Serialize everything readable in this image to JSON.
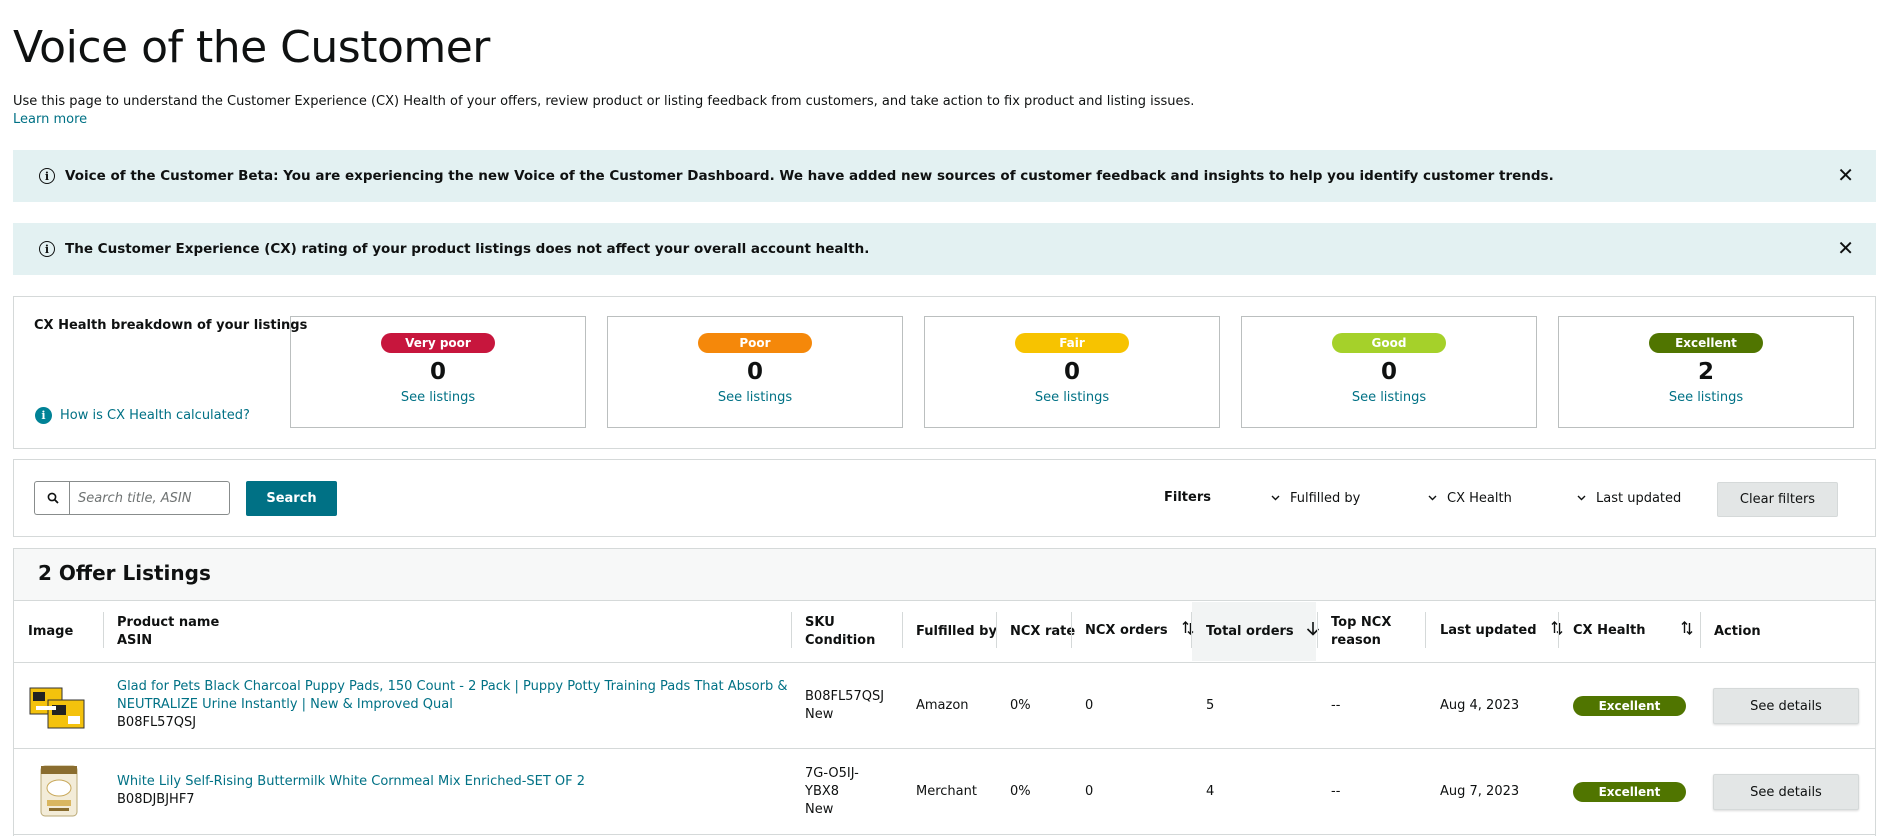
{
  "header": {
    "title": "Voice of the Customer",
    "description": "Use this page to understand the Customer Experience (CX) Health of your offers, review product or listing feedback from customers, and take action to fix product and listing issues.",
    "learn_more": "Learn more"
  },
  "alerts": [
    {
      "icon": "info-icon",
      "message": "Voice of the Customer Beta: You are experiencing the new Voice of the Customer Dashboard. We have added new sources of customer feedback and insights to help you identify customer trends.",
      "close": "✕"
    },
    {
      "icon": "info-icon",
      "message": "The Customer Experience (CX) rating of your product listings does not affect your overall account health.",
      "close": "✕"
    }
  ],
  "cx_breakdown": {
    "title": "CX Health breakdown of your listings",
    "help_link": "How is CX Health calculated?",
    "cards": [
      {
        "label": "Very poor",
        "count": "0",
        "link": "See listings",
        "color": "#c7163d"
      },
      {
        "label": "Poor",
        "count": "0",
        "link": "See listings",
        "color": "#f5880a"
      },
      {
        "label": "Fair",
        "count": "0",
        "link": "See listings",
        "color": "#f7c300"
      },
      {
        "label": "Good",
        "count": "0",
        "link": "See listings",
        "color": "#a5d12a"
      },
      {
        "label": "Excellent",
        "count": "2",
        "link": "See listings",
        "color": "#507500"
      }
    ]
  },
  "search": {
    "placeholder": "Search title, ASIN",
    "button": "Search",
    "filters_label": "Filters",
    "filters": [
      "Fulfilled by",
      "CX Health",
      "Last updated"
    ],
    "clear_button": "Clear filters"
  },
  "table": {
    "title": "2 Offer Listings",
    "columns": {
      "image": "Image",
      "product_name": "Product name",
      "asin": "ASIN",
      "sku": "SKU",
      "condition": "Condition",
      "fulfilled_by": "Fulfilled by",
      "ncx_rate": "NCX rate",
      "ncx_orders": "NCX orders",
      "total_orders": "Total orders",
      "top_ncx_reason_1": "Top NCX",
      "top_ncx_reason_2": "reason",
      "last_updated": "Last updated",
      "cx_health": "CX Health",
      "action": "Action"
    },
    "rows": [
      {
        "name_line1": "Glad for Pets Black Charcoal Puppy Pads, 150 Count - 2 Pack | Puppy Potty Training Pads That Absorb &",
        "name_line2": "NEUTRALIZE Urine Instantly | New & Improved Qual",
        "asin": "B08FL57QSJ",
        "sku_line1": "B08FL57QSJ",
        "sku_line2": "",
        "condition": "New",
        "fulfilled_by": "Amazon",
        "ncx_rate": "0%",
        "ncx_orders": "0",
        "total_orders": "5",
        "top_ncx_reason": "--",
        "last_updated": "Aug 4, 2023",
        "cx_health": "Excellent",
        "action": "See details"
      },
      {
        "name_line1": "White Lily Self-Rising Buttermilk White Cornmeal Mix Enriched-SET OF 2",
        "name_line2": "",
        "asin": "B08DJBJHF7",
        "sku_line1": "7G-O5IJ-",
        "sku_line2": "YBX8",
        "condition": "New",
        "fulfilled_by": "Merchant",
        "ncx_rate": "0%",
        "ncx_orders": "0",
        "total_orders": "4",
        "top_ncx_reason": "--",
        "last_updated": "Aug 7, 2023",
        "cx_health": "Excellent",
        "action": "See details"
      }
    ]
  }
}
